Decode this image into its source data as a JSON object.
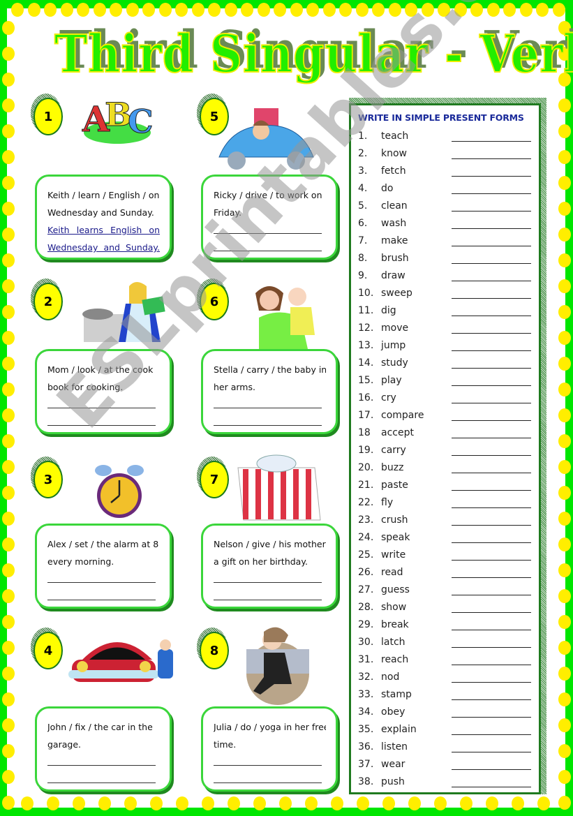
{
  "title": "Third Singular - Verbs",
  "colors": {
    "border_green": "#00e600",
    "dot_yellow": "#ffee00",
    "title_green": "#22ee00",
    "card_border": "#3bd63b",
    "list_border": "#1f7a1f",
    "list_title": "#1a2a9a",
    "answer_blue": "#1a1a8a"
  },
  "exercises": [
    {
      "number": "1",
      "picture": "abc-letters-picture",
      "prompt_lines": [
        "Keith / learn / English / on",
        "Wednesday and Sunday."
      ],
      "answer_lines": [
        "Keith learns English on",
        "Wednesday and Sunday."
      ]
    },
    {
      "number": "2",
      "picture": "mom-cooking-picture",
      "prompt_lines": [
        "Mom / look / at the cook",
        "book for cooking."
      ],
      "answer_lines": []
    },
    {
      "number": "3",
      "picture": "alarm-clock-picture",
      "prompt_lines": [
        "Alex / set / the alarm at 8",
        "every morning."
      ],
      "answer_lines": []
    },
    {
      "number": "4",
      "picture": "mechanic-car-picture",
      "prompt_lines": [
        "John / fix / the car in the",
        "garage."
      ],
      "answer_lines": []
    },
    {
      "number": "5",
      "picture": "driving-car-picture",
      "prompt_lines": [
        "Ricky / drive / to work on",
        "Friday."
      ],
      "answer_lines": []
    },
    {
      "number": "6",
      "picture": "mother-baby-picture",
      "prompt_lines": [
        "Stella / carry / the baby in",
        "her arms."
      ],
      "answer_lines": []
    },
    {
      "number": "7",
      "picture": "gift-box-picture",
      "prompt_lines": [
        "Nelson / give / his mother",
        "a gift on her birthday."
      ],
      "answer_lines": []
    },
    {
      "number": "8",
      "picture": "yoga-woman-picture",
      "prompt_lines": [
        "Julia / do / yoga in her free",
        "time."
      ],
      "answer_lines": []
    }
  ],
  "verb_list": {
    "title": "WRITE IN SIMPLE PRESENT FORMS",
    "items": [
      {
        "num": "1.",
        "verb": "teach"
      },
      {
        "num": "2.",
        "verb": "know"
      },
      {
        "num": "3.",
        "verb": "fetch"
      },
      {
        "num": "4.",
        "verb": "do"
      },
      {
        "num": "5.",
        "verb": "clean"
      },
      {
        "num": "6.",
        "verb": "wash"
      },
      {
        "num": "7.",
        "verb": "make"
      },
      {
        "num": "8.",
        "verb": "brush"
      },
      {
        "num": "9.",
        "verb": "draw"
      },
      {
        "num": "10.",
        "verb": "sweep"
      },
      {
        "num": "11.",
        "verb": "dig"
      },
      {
        "num": "12.",
        "verb": "move"
      },
      {
        "num": "13.",
        "verb": "jump"
      },
      {
        "num": "14.",
        "verb": "study"
      },
      {
        "num": "15.",
        "verb": "play"
      },
      {
        "num": "16.",
        "verb": "cry"
      },
      {
        "num": "17.",
        "verb": "compare"
      },
      {
        "num": "18",
        "verb": "accept"
      },
      {
        "num": "19.",
        "verb": "carry"
      },
      {
        "num": "20.",
        "verb": "buzz"
      },
      {
        "num": "21.",
        "verb": "paste"
      },
      {
        "num": "22.",
        "verb": "fly"
      },
      {
        "num": "23.",
        "verb": "crush"
      },
      {
        "num": "24.",
        "verb": "speak"
      },
      {
        "num": "25.",
        "verb": "write"
      },
      {
        "num": "26.",
        "verb": "read"
      },
      {
        "num": "27.",
        "verb": "guess"
      },
      {
        "num": "28.",
        "verb": "show"
      },
      {
        "num": "29.",
        "verb": "break"
      },
      {
        "num": "30.",
        "verb": "latch"
      },
      {
        "num": "31.",
        "verb": "reach"
      },
      {
        "num": "32.",
        "verb": "nod"
      },
      {
        "num": "33.",
        "verb": "stamp"
      },
      {
        "num": "34.",
        "verb": "obey"
      },
      {
        "num": "35.",
        "verb": "explain"
      },
      {
        "num": "36.",
        "verb": "listen"
      },
      {
        "num": "37.",
        "verb": "wear"
      },
      {
        "num": "38.",
        "verb": "push"
      }
    ]
  },
  "watermark": "ESLprintables.com"
}
